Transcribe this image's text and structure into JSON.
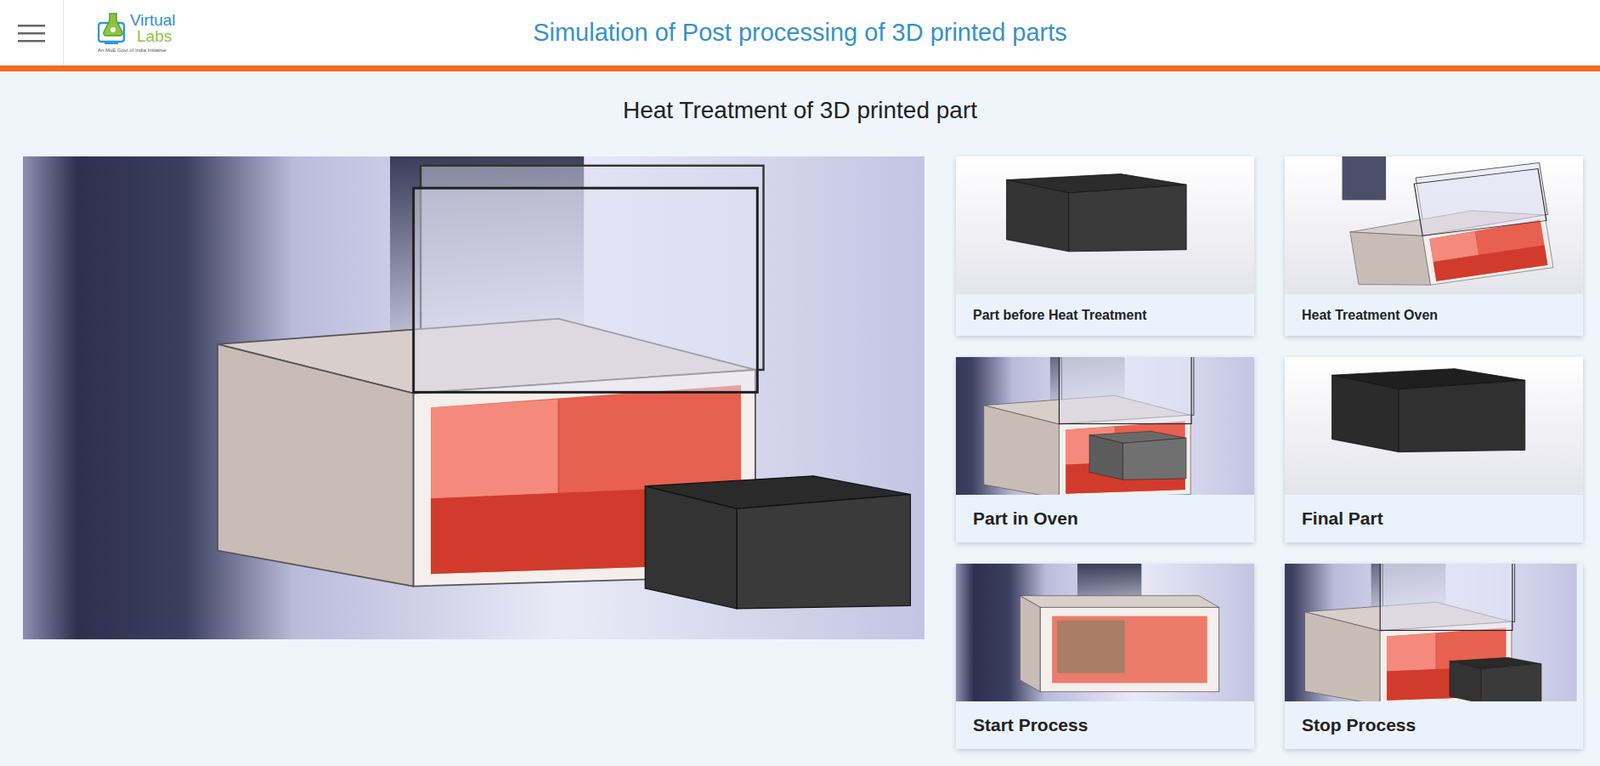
{
  "header": {
    "title": "Simulation of Post processing of 3D printed parts"
  },
  "logo": {
    "word1": "Virtual",
    "word2": "Labs",
    "tagline": "An MoE Govt of India Initiative"
  },
  "heading": "Heat Treatment of 3D printed part",
  "cards": [
    {
      "label": "Part before Heat Treatment"
    },
    {
      "label": "Heat Treatment Oven"
    },
    {
      "label": "Part in Oven"
    },
    {
      "label": "Final Part"
    },
    {
      "label": "Start Process"
    },
    {
      "label": "Stop Process"
    }
  ]
}
